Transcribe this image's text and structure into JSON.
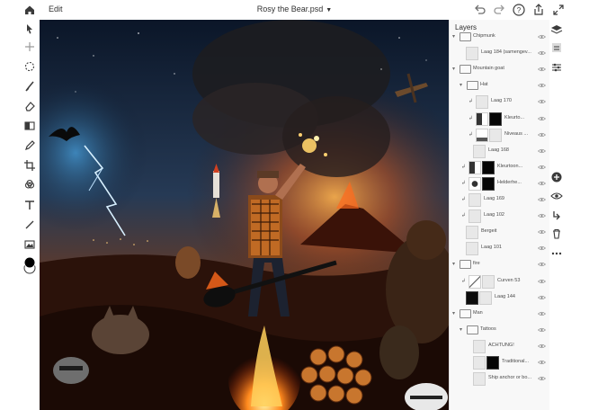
{
  "topbar": {
    "edit": "Edit",
    "doc_title": "Rosy the Bear.psd"
  },
  "layers_panel": {
    "title": "Layers",
    "layers": [
      {
        "name": "Chipmunk",
        "depth": 0,
        "kind": "group-partial"
      },
      {
        "name": "Laag 184 (samengev...",
        "depth": 1,
        "kind": "pixel"
      },
      {
        "name": "Mountain goat",
        "depth": 0,
        "kind": "group"
      },
      {
        "name": "Hat",
        "depth": 1,
        "kind": "group"
      },
      {
        "name": "Laag 170",
        "depth": 2,
        "kind": "pixel",
        "clipped": true
      },
      {
        "name": "Kleurto...",
        "depth": 2,
        "kind": "adjust-mask",
        "clipped": true
      },
      {
        "name": "Niveaus ...",
        "depth": 2,
        "kind": "levels",
        "clipped": true
      },
      {
        "name": "Laag 168",
        "depth": 2,
        "kind": "pixel"
      },
      {
        "name": "Kleurtoon...",
        "depth": 1,
        "kind": "adjust-mask",
        "clipped": true
      },
      {
        "name": "Helderhe...",
        "depth": 1,
        "kind": "brightness",
        "clipped": true
      },
      {
        "name": "Laag 169",
        "depth": 1,
        "kind": "pixel",
        "clipped": true
      },
      {
        "name": "Laag 102",
        "depth": 1,
        "kind": "pixel",
        "clipped": true
      },
      {
        "name": "Bergeit",
        "depth": 1,
        "kind": "pixel"
      },
      {
        "name": "Laag 101",
        "depth": 1,
        "kind": "pixel"
      },
      {
        "name": "fire",
        "depth": 0,
        "kind": "group"
      },
      {
        "name": "Curven 53",
        "depth": 1,
        "kind": "curves",
        "clipped": true
      },
      {
        "name": "Laag 144",
        "depth": 1,
        "kind": "pixel-mask"
      },
      {
        "name": "Man",
        "depth": 0,
        "kind": "group"
      },
      {
        "name": "Tattoos",
        "depth": 1,
        "kind": "group"
      },
      {
        "name": "ACHTUNG!",
        "depth": 2,
        "kind": "pixel"
      },
      {
        "name": "Traditional...",
        "depth": 2,
        "kind": "pixel-black"
      },
      {
        "name": "Ship anchor or bo...",
        "depth": 2,
        "kind": "pixel"
      }
    ]
  },
  "colors": {
    "accent": "#1473e6",
    "panel_bg": "#f8f8f8",
    "canvas_bg": "#1a1412"
  }
}
